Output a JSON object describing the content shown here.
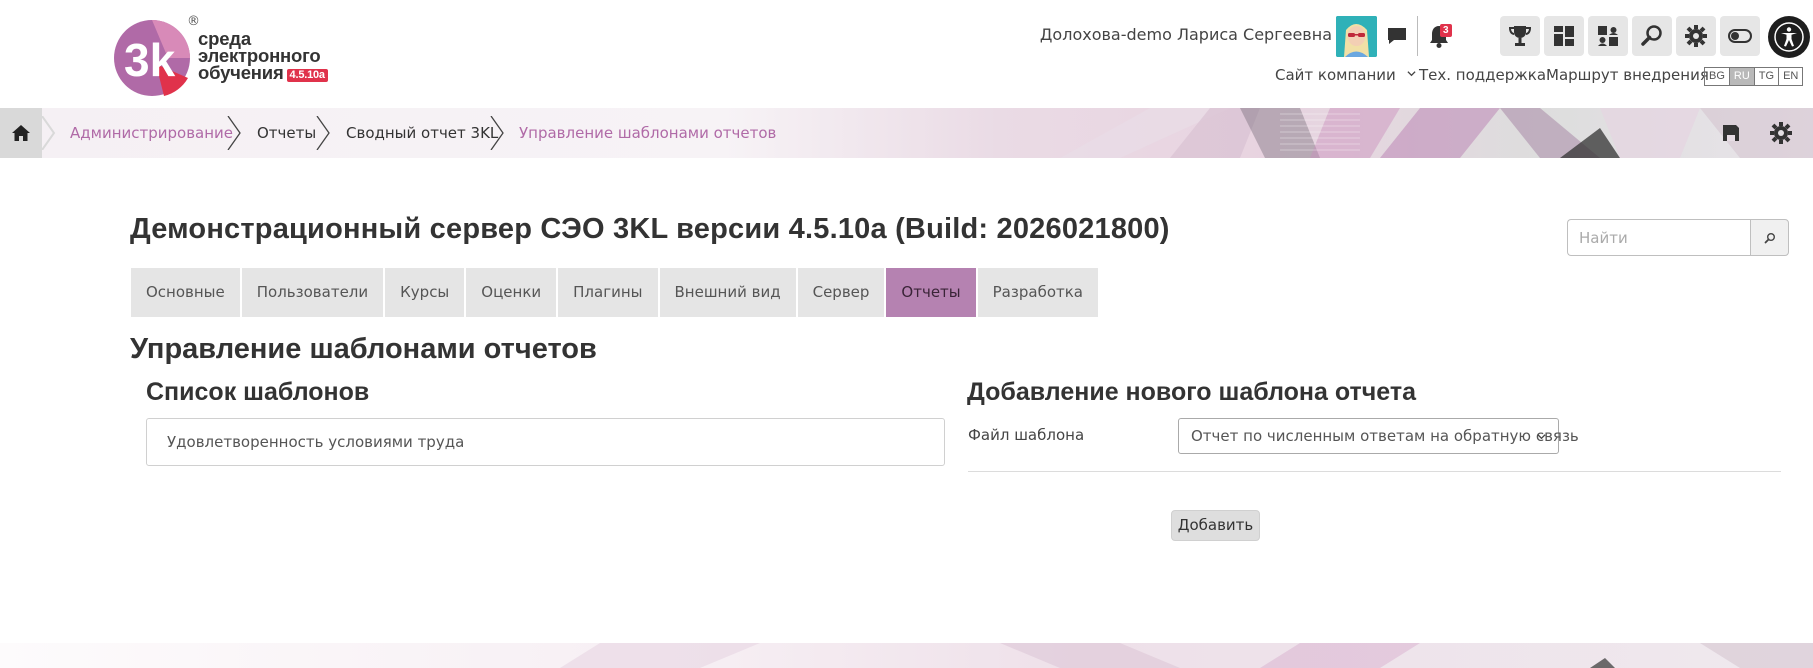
{
  "header": {
    "logo": {
      "mark_text": "3K",
      "registered": "®",
      "line1": "среда",
      "line2": "электронного",
      "line3": "обучения",
      "version_badge": "4.5.10a"
    },
    "user_name": "Долохова-demo Лариса Сергеевна",
    "notifications_count": "3",
    "icons": [
      "trophy-icon",
      "dashboard-icon",
      "users-icon",
      "search-icon",
      "gear-icon",
      "toggle-icon",
      "accessibility-icon"
    ],
    "nav": {
      "company_site": "Сайт компании",
      "support": "Тех. поддержка",
      "route": "Маршрут внедрения"
    },
    "languages": [
      {
        "code": "BG",
        "active": false
      },
      {
        "code": "RU",
        "active": true
      },
      {
        "code": "TG",
        "active": false
      },
      {
        "code": "EN",
        "active": false
      }
    ]
  },
  "breadcrumb": {
    "items": [
      {
        "label": "Администрирование",
        "link": true
      },
      {
        "label": "Отчеты",
        "link": false
      },
      {
        "label": "Сводный отчет 3KL",
        "link": false
      },
      {
        "label": "Управление шаблонами отчетов",
        "link": true
      }
    ]
  },
  "main": {
    "site_title": "Демонстрационный сервер СЭО 3KL версии 4.5.10a (Build: 2026021800)",
    "search": {
      "placeholder": "Найти"
    },
    "tabs": [
      {
        "label": "Основные",
        "active": false
      },
      {
        "label": "Пользователи",
        "active": false
      },
      {
        "label": "Курсы",
        "active": false
      },
      {
        "label": "Оценки",
        "active": false
      },
      {
        "label": "Плагины",
        "active": false
      },
      {
        "label": "Внешний вид",
        "active": false
      },
      {
        "label": "Сервер",
        "active": false
      },
      {
        "label": "Отчеты",
        "active": true
      },
      {
        "label": "Разработка",
        "active": false
      }
    ],
    "page_heading": "Управление шаблонами отчетов",
    "templates_list": {
      "title": "Список шаблонов",
      "items": [
        "Удовлетворенность условиями труда"
      ]
    },
    "add_template": {
      "title": "Добавление нового шаблона отчета",
      "file_label": "Файл шаблона",
      "file_value": "Отчет по численным ответам на обратную связь",
      "submit_label": "Добавить"
    }
  },
  "colors": {
    "accent": "#b582b1",
    "link": "#b06aa7",
    "badge": "#e0324b"
  }
}
